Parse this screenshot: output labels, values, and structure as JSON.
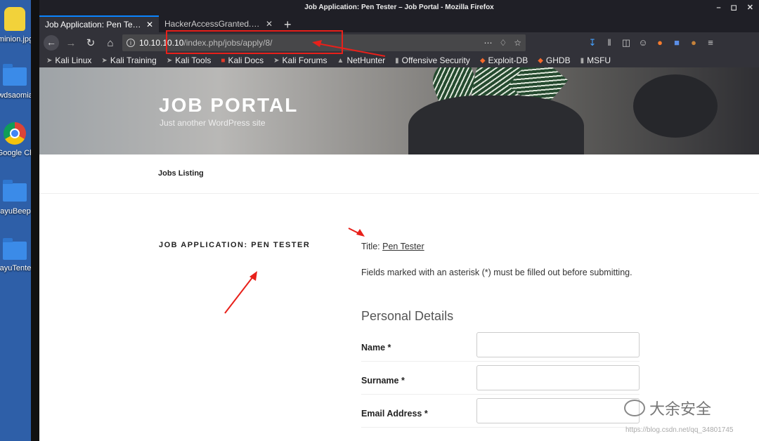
{
  "desktop": {
    "icons": [
      {
        "label": "minion.jpg",
        "type": "image"
      },
      {
        "label": "wdsaomia",
        "type": "folder"
      },
      {
        "label": "Google Ch",
        "type": "chrome"
      },
      {
        "label": "ayuBeep",
        "type": "folder"
      },
      {
        "label": "ayuTente",
        "type": "folder"
      }
    ]
  },
  "window": {
    "title": "Job Application: Pen Tester – Job Portal - Mozilla Firefox"
  },
  "tabs": [
    {
      "title": "Job Application: Pen Tester –",
      "active": true
    },
    {
      "title": "HackerAccessGranted.jpg (J",
      "active": false
    }
  ],
  "urlbar": {
    "host": "10.10.10.10",
    "path": "/index.php/jobs/apply/8/"
  },
  "bookmarks": [
    {
      "label": "Kali Linux",
      "icon": "kali-icon"
    },
    {
      "label": "Kali Training",
      "icon": "kali-icon"
    },
    {
      "label": "Kali Tools",
      "icon": "kali-icon"
    },
    {
      "label": "Kali Docs",
      "icon": "kali-docs-icon"
    },
    {
      "label": "Kali Forums",
      "icon": "kali-icon"
    },
    {
      "label": "NetHunter",
      "icon": "nethunter-icon"
    },
    {
      "label": "Offensive Security",
      "icon": "offsec-icon"
    },
    {
      "label": "Exploit-DB",
      "icon": "exploitdb-icon"
    },
    {
      "label": "GHDB",
      "icon": "ghdb-icon"
    },
    {
      "label": "MSFU",
      "icon": "msfu-icon"
    }
  ],
  "site": {
    "title": "JOB PORTAL",
    "tagline": "Just another WordPress site",
    "nav": [
      "Jobs Listing"
    ]
  },
  "entry": {
    "title": "JOB APPLICATION: PEN TESTER",
    "job_label": "Title:",
    "job_title": "Pen Tester",
    "required_note": "Fields marked with an asterisk (*) must be filled out before submitting.",
    "section_heading": "Personal Details",
    "fields": [
      {
        "label": "Name *",
        "value": ""
      },
      {
        "label": "Surname *",
        "value": ""
      },
      {
        "label": "Email Address *",
        "value": ""
      }
    ]
  },
  "watermark": {
    "text": "大余安全",
    "url": "https://blog.csdn.net/qq_34801745"
  },
  "colors": {
    "accent": "#0a84ff",
    "annotation": "#e8201a"
  }
}
